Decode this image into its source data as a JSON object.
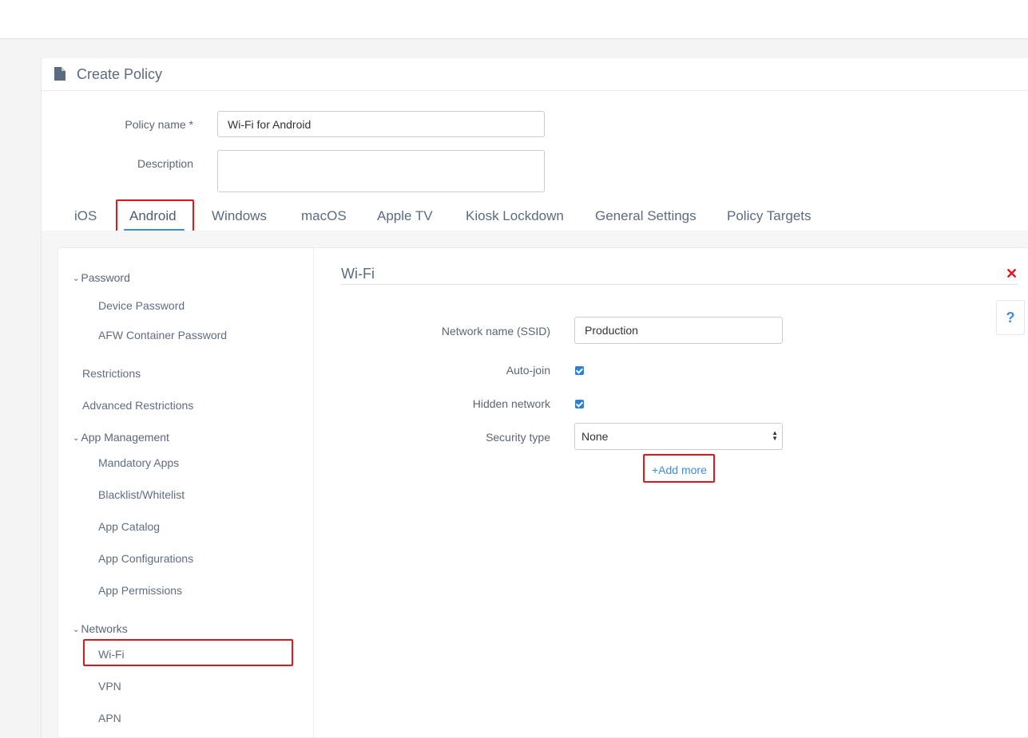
{
  "page": {
    "title": "Create Policy"
  },
  "form": {
    "policy_name_label": "Policy name *",
    "policy_name_value": "Wi-Fi for Android",
    "description_label": "Description",
    "description_value": ""
  },
  "tabs": [
    {
      "label": "iOS"
    },
    {
      "label": "Android"
    },
    {
      "label": "Windows"
    },
    {
      "label": "macOS"
    },
    {
      "label": "Apple TV"
    },
    {
      "label": "Kiosk Lockdown"
    },
    {
      "label": "General Settings"
    },
    {
      "label": "Policy Targets"
    }
  ],
  "sidebar": {
    "password_group": "Password",
    "device_password": "Device Password",
    "afw_container_password": "AFW Container Password",
    "restrictions": "Restrictions",
    "advanced_restrictions": "Advanced Restrictions",
    "app_management_group": "App Management",
    "mandatory_apps": "Mandatory Apps",
    "blacklist_whitelist": "Blacklist/Whitelist",
    "app_catalog": "App Catalog",
    "app_configurations": "App Configurations",
    "app_permissions": "App Permissions",
    "networks_group": "Networks",
    "wifi": "Wi-Fi",
    "vpn": "VPN",
    "apn": "APN",
    "chevron": "⌄"
  },
  "wifi_section": {
    "title": "Wi-Fi",
    "close_symbol": "✕",
    "help_symbol": "?",
    "ssid_label": "Network name (SSID)",
    "ssid_value": "Production",
    "auto_join_label": "Auto-join",
    "auto_join_checked": true,
    "hidden_network_label": "Hidden network",
    "hidden_network_checked": true,
    "security_type_label": "Security type",
    "security_type_value": "None",
    "add_more_label": "+Add more"
  },
  "colors": {
    "accent": "#3e8ddb",
    "highlight": "#e0181b",
    "text": "#5a6675"
  }
}
